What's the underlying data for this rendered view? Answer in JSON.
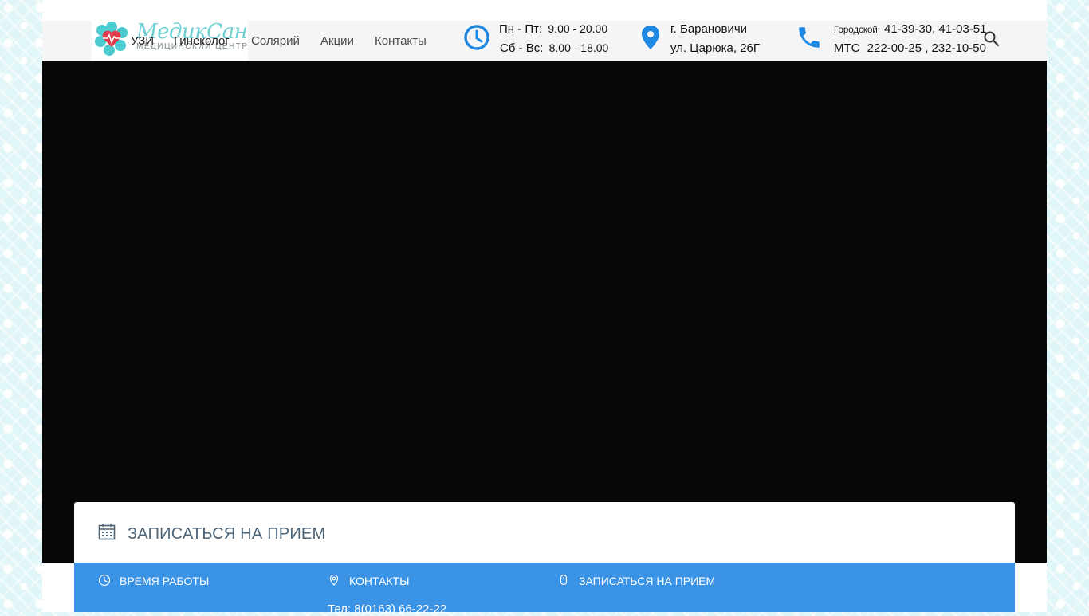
{
  "header": {
    "logo": {
      "name": "МедикСан",
      "subtitle": "МЕДИЦИНСКИЙ ЦЕНТР"
    },
    "nav": [
      "УЗИ",
      "Гинеколог",
      "Солярий",
      "Акции",
      "Контакты"
    ],
    "hours": {
      "weekdays_label": "Пн - Пт:",
      "weekdays_value": "9.00 - 20.00",
      "weekend_label": "Сб - Вс:",
      "weekend_value": "8.00 - 18.00"
    },
    "address": {
      "city": "г. Барановичи",
      "street": "ул. Царюка, 26Г"
    },
    "phones": {
      "city_label": "Городской",
      "city_numbers": "41-39-30, 41-03-51",
      "mts_label": "МТС",
      "mts_numbers": "222-00-25 , 232-10-50"
    },
    "icons": {
      "clock": "clock-icon",
      "pin": "map-pin-icon",
      "phone": "phone-icon",
      "search": "search-icon"
    },
    "accent_color": "#1e88e5"
  },
  "booking": {
    "title": "ЗАПИСАТЬСЯ НА ПРИЕМ",
    "icon": "calendar-icon"
  },
  "footer_panel": {
    "background": "#3b93e6",
    "columns": [
      {
        "label": "ВРЕМЯ РАБОТЫ",
        "icon": "clock-icon"
      },
      {
        "label": "КОНТАКТЫ",
        "icon": "map-pin-icon"
      },
      {
        "label": "ЗАПИСАТЬСЯ НА ПРИЕМ",
        "icon": "mouse-icon"
      }
    ],
    "phone_line": "Тел: 8(0163) 66-22-22"
  }
}
